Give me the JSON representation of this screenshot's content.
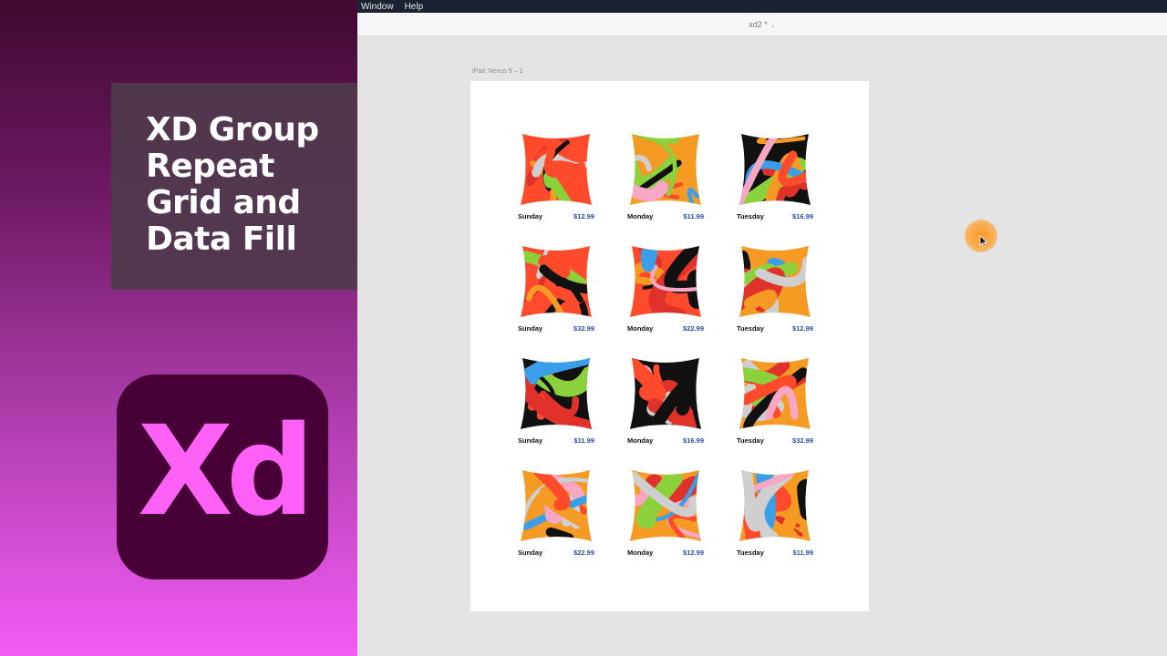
{
  "promo": {
    "title_lines": [
      "XD Group",
      "Repeat",
      "Grid and",
      "Data Fill"
    ],
    "logo_text": "Xd",
    "colors": {
      "logo_bg": "#470137",
      "logo_fg": "#FF61F6"
    }
  },
  "menubar": {
    "items": [
      "Window",
      "Help"
    ]
  },
  "titlebar": {
    "doc_title": "xd2 *",
    "chevron": "⌄"
  },
  "artboard": {
    "label": "iPad, Nexus 9 – 1"
  },
  "grid": {
    "items": [
      {
        "day": "Sunday",
        "price": "$12.99"
      },
      {
        "day": "Monday",
        "price": "$11.99"
      },
      {
        "day": "Tuesday",
        "price": "$16.99"
      },
      {
        "day": "Sunday",
        "price": "$32.99"
      },
      {
        "day": "Monday",
        "price": "$22.99"
      },
      {
        "day": "Tuesday",
        "price": "$12.99"
      },
      {
        "day": "Sunday",
        "price": "$11.99"
      },
      {
        "day": "Monday",
        "price": "$16.99"
      },
      {
        "day": "Tuesday",
        "price": "$32.99"
      },
      {
        "day": "Sunday",
        "price": "$22.99"
      },
      {
        "day": "Monday",
        "price": "$12.99"
      },
      {
        "day": "Tuesday",
        "price": "$11.99"
      }
    ],
    "palette": [
      "#111111",
      "#ff4b2b",
      "#f59a23",
      "#8bd13c",
      "#3a9fe8",
      "#f7a6c4",
      "#cfcfcf",
      "#e0312b"
    ]
  }
}
